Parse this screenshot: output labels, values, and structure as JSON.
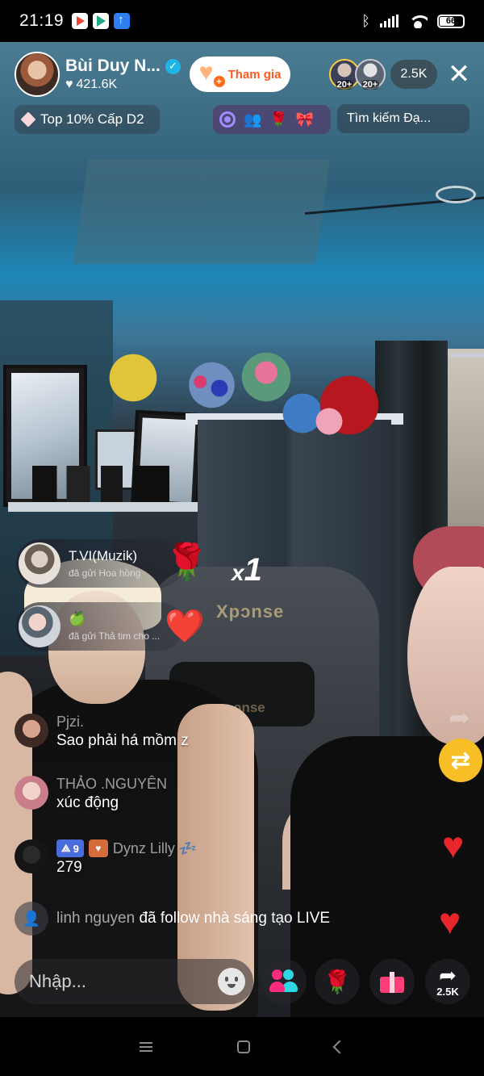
{
  "status_bar": {
    "time": "21:19",
    "battery": "66",
    "icons": [
      "youtube-music-icon",
      "play-store-icon",
      "upload-icon",
      "bluetooth-icon",
      "signal-icon",
      "wifi-icon",
      "battery-icon"
    ]
  },
  "host": {
    "name": "Bùi Duy N...",
    "likes": "421.6K",
    "join_label": "Tham gia"
  },
  "viewers": {
    "badge_1": "20+",
    "badge_2": "20+",
    "count": "2.5K"
  },
  "ranking": {
    "label": "Top 10% Cấp D2"
  },
  "search": {
    "label": "Tìm kiếm Đạ..."
  },
  "gifts": [
    {
      "name": "T.VI(Muzik)",
      "action": "đã gửi Hoa hồng"
    },
    {
      "name": "🍏",
      "action": "đã gửi Thả tim cho ..."
    }
  ],
  "combo": {
    "prefix": "x",
    "count": "1"
  },
  "chat": [
    {
      "user": "Pjzi.",
      "message": "Sao phải há mồm z"
    },
    {
      "user": "THẢO .NGUYÊN",
      "message": "xúc động"
    },
    {
      "user": "Dynz Lilly 💤",
      "level": "9",
      "message": "279"
    }
  ],
  "follow_event": {
    "user": "linh nguyen",
    "text": "đã follow nhà sáng tạo LIVE"
  },
  "bottom_bar": {
    "input_placeholder": "Nhập...",
    "share_count": "2.5K"
  },
  "colors": {
    "join_text": "#fe5a1e",
    "repost": "#f7be25",
    "heart": "#e8262c",
    "verified": "#1fb6e7"
  }
}
